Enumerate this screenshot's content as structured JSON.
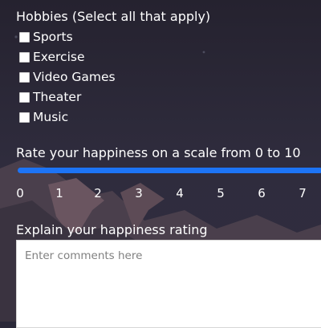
{
  "hobbies": {
    "question": "Hobbies (Select all that apply)",
    "options": [
      "Sports",
      "Exercise",
      "Video Games",
      "Theater",
      "Music"
    ]
  },
  "happiness": {
    "question": "Rate your happiness on a scale from 0 to 10",
    "ticks": [
      "0",
      "1",
      "2",
      "3",
      "4",
      "5",
      "6",
      "7"
    ]
  },
  "explain": {
    "question": "Explain your happiness rating",
    "placeholder": "Enter comments here"
  },
  "colors": {
    "background": "#2a2838",
    "slider_accent": "#1d74f5"
  }
}
